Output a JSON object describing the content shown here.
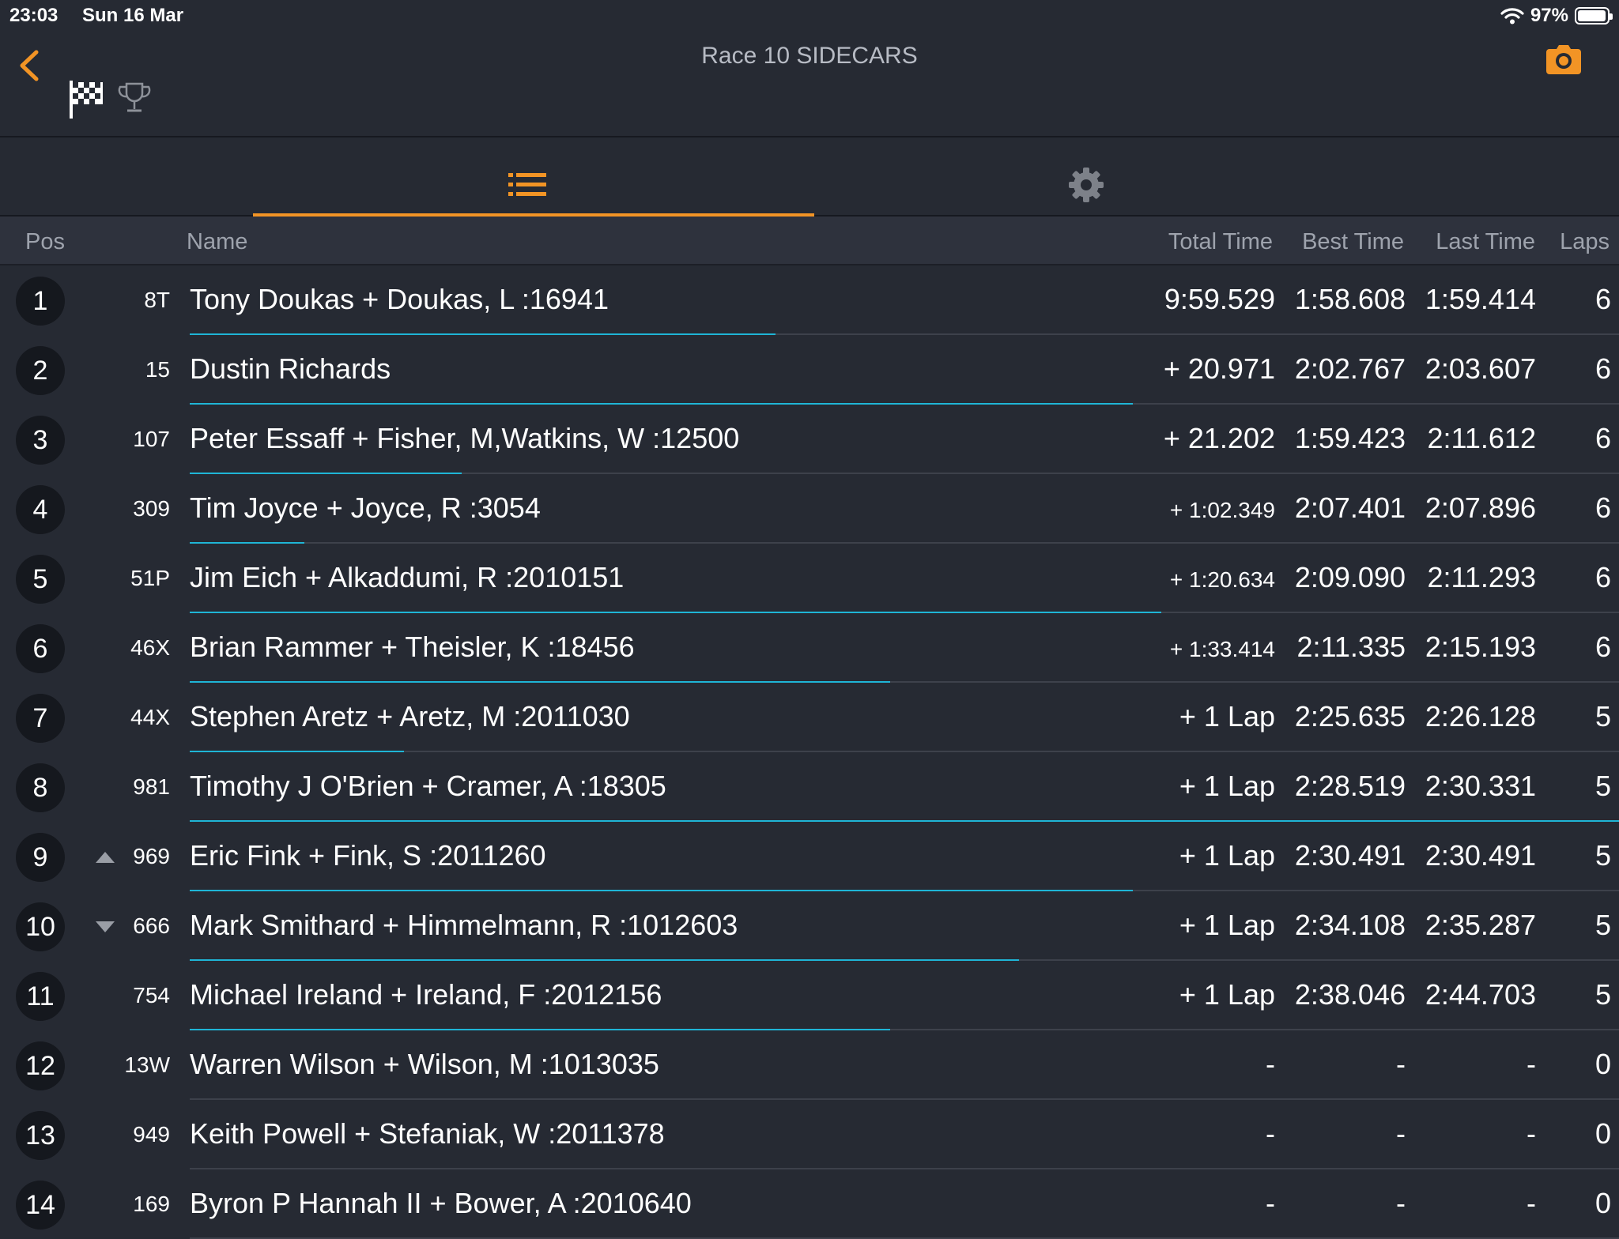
{
  "status_bar": {
    "time": "23:03",
    "date": "Sun 16 Mar",
    "battery": "97%",
    "battery_level": 0.97
  },
  "nav": {
    "title": "Race 10 SIDECARS"
  },
  "colors": {
    "accent": "#f29425",
    "progress": "#1fb5d6",
    "background": "#262a33"
  },
  "table": {
    "headers": {
      "pos": "Pos",
      "name": "Name",
      "total": "Total Time",
      "best": "Best Time",
      "last": "Last Time",
      "laps": "Laps"
    }
  },
  "rows": [
    {
      "pos": "1",
      "num": "8T",
      "trend": "",
      "name": "Tony Doukas + Doukas, L :16941",
      "total": "9:59.529",
      "best": "1:58.608",
      "last": "1:59.414",
      "laps": "6",
      "progress": 0.41
    },
    {
      "pos": "2",
      "num": "15",
      "trend": "",
      "name": "Dustin Richards",
      "total": "+ 20.971",
      "best": "2:02.767",
      "last": "2:03.607",
      "laps": "6",
      "progress": 0.66
    },
    {
      "pos": "3",
      "num": "107",
      "trend": "",
      "name": "Peter Essaff + Fisher, M,Watkins, W :12500",
      "total": "+ 21.202",
      "best": "1:59.423",
      "last": "2:11.612",
      "laps": "6",
      "progress": 0.19
    },
    {
      "pos": "4",
      "num": "309",
      "trend": "",
      "name": "Tim Joyce + Joyce, R :3054",
      "total": "+ 1:02.349",
      "best": "2:07.401",
      "last": "2:07.896",
      "laps": "6",
      "progress": 0.08
    },
    {
      "pos": "5",
      "num": "51P",
      "trend": "",
      "name": "Jim Eich + Alkaddumi, R :2010151",
      "total": "+ 1:20.634",
      "best": "2:09.090",
      "last": "2:11.293",
      "laps": "6",
      "progress": 0.68
    },
    {
      "pos": "6",
      "num": "46X",
      "trend": "",
      "name": "Brian Rammer + Theisler, K :18456",
      "total": "+ 1:33.414",
      "best": "2:11.335",
      "last": "2:15.193",
      "laps": "6",
      "progress": 0.49
    },
    {
      "pos": "7",
      "num": "44X",
      "trend": "",
      "name": "Stephen Aretz + Aretz, M :2011030",
      "total": "+ 1 Lap",
      "best": "2:25.635",
      "last": "2:26.128",
      "laps": "5",
      "progress": 0.15
    },
    {
      "pos": "8",
      "num": "981",
      "trend": "",
      "name": "Timothy J O'Brien + Cramer, A :18305",
      "total": "+ 1 Lap",
      "best": "2:28.519",
      "last": "2:30.331",
      "laps": "5",
      "progress": 1.0
    },
    {
      "pos": "9",
      "num": "969",
      "trend": "up",
      "name": "Eric Fink + Fink, S :2011260",
      "total": "+ 1 Lap",
      "best": "2:30.491",
      "last": "2:30.491",
      "laps": "5",
      "progress": 0.66
    },
    {
      "pos": "10",
      "num": "666",
      "trend": "down",
      "name": "Mark Smithard + Himmelmann, R :1012603",
      "total": "+ 1 Lap",
      "best": "2:34.108",
      "last": "2:35.287",
      "laps": "5",
      "progress": 0.58
    },
    {
      "pos": "11",
      "num": "754",
      "trend": "",
      "name": "Michael Ireland + Ireland, F :2012156",
      "total": "+ 1 Lap",
      "best": "2:38.046",
      "last": "2:44.703",
      "laps": "5",
      "progress": 0.49
    },
    {
      "pos": "12",
      "num": "13W",
      "trend": "",
      "name": "Warren Wilson + Wilson, M :1013035",
      "total": "-",
      "best": "-",
      "last": "-",
      "laps": "0",
      "progress": 0
    },
    {
      "pos": "13",
      "num": "949",
      "trend": "",
      "name": "Keith Powell + Stefaniak, W :2011378",
      "total": "-",
      "best": "-",
      "last": "-",
      "laps": "0",
      "progress": 0
    },
    {
      "pos": "14",
      "num": "169",
      "trend": "",
      "name": "Byron P Hannah II + Bower, A :2010640",
      "total": "-",
      "best": "-",
      "last": "-",
      "laps": "0",
      "progress": 0
    }
  ]
}
